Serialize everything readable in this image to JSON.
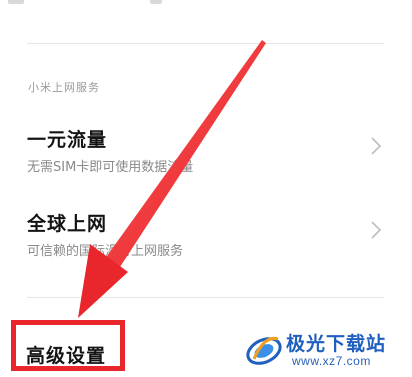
{
  "section": {
    "header": "小米上网服务"
  },
  "items": [
    {
      "title": "一元流量",
      "subtitle": "无需SIM卡即可使用数据流量"
    },
    {
      "title": "全球上网",
      "subtitle": "可信赖的国际漫游上网服务"
    }
  ],
  "advanced": {
    "title": "高级设置"
  },
  "watermark": {
    "name": "极光下载站",
    "url": "www.xz7.com"
  },
  "colors": {
    "annotation_red": "#e8262c",
    "watermark_blue": "#1f5fbf"
  },
  "icons": {
    "chevron": "chevron-right-icon",
    "annotation_arrow": "arrow-icon"
  }
}
